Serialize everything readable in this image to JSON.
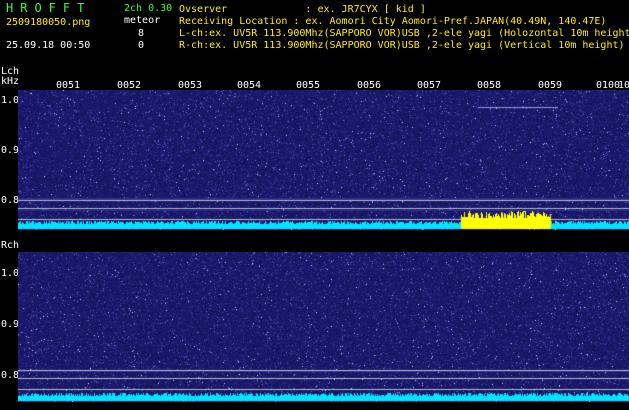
{
  "header": {
    "brand": "HROFFT",
    "channels": "2ch 0.30",
    "filename": "2509180050.png",
    "mode": "meteor",
    "datetime": "25.09.18 00:50",
    "lch_count": "8",
    "rch_count": "0",
    "observer": "Ovserver             : ex. JR7CYX [ kid ]",
    "location": "Receiving Location : ex. Aomori City Aomori-Pref.JAPAN(40.49N, 140.47E)",
    "lch_info": "L-ch:ex. UV5R 113.900Mhz(SAPPORO VOR)USB ,2-ele yagi (Holozontal 10m height",
    "rch_info": "R-ch:ex. UV5R 113.900Mhz(SAPPORO VOR)USB ,2-ele yagi (Vertical 10m height)"
  },
  "lch": {
    "label": "Lch",
    "unit": "kHz",
    "freq_labels": [
      "1.0",
      "0.9",
      "0.8"
    ],
    "time_labels": [
      "0051",
      "0052",
      "0053",
      "0054",
      "0055",
      "0056",
      "0057",
      "0058",
      "0059",
      "0100"
    ],
    "edge_label": "10"
  },
  "rch": {
    "label": "Rch",
    "freq_labels": [
      "1.0",
      "0.9",
      "0.8"
    ]
  },
  "colors": {
    "background": "#000000",
    "waterfall_base": "#1a1a6e",
    "level_trace": "#00e5ff",
    "meteor_burst": "#ffff00",
    "brand_green": "#33ff33"
  }
}
